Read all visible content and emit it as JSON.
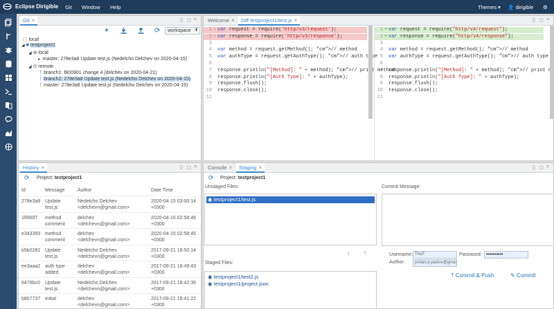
{
  "app": {
    "title": "Eclipse Dirigible",
    "menu": [
      "Git",
      "Window",
      "Help"
    ],
    "themes_label": "Themes",
    "user": "dirigible"
  },
  "git_panel": {
    "tab": "Git",
    "workspace": "workspace",
    "tree": {
      "local_root": "local",
      "project": "testproject1",
      "local": "local",
      "local_master": "master: 278e3a8 Update test.js (Nedelcho Delchev on 2020-04-15)",
      "remote": "remote",
      "branch1": "branch1: f800901 change 4 (delchev on 2020-04-21)",
      "branch2": "branch2: 278e3a8 Update test.js (Nedelcho Delchev on 2020-04-15)",
      "remote_master": "master: 278e3a8 Update test.js (Nedelcho Delchev on 2020-04-15)"
    }
  },
  "editor": {
    "tabs": [
      "Welcome",
      "Diff testproject1/test.js"
    ],
    "left_lines": [
      {
        "n": "1",
        "text": "var request = require('http/v3/request');"
      },
      {
        "n": "2",
        "text": "var response = require('http/v3/response');"
      },
      {
        "n": "3",
        "text": ""
      },
      {
        "n": "4",
        "text": "var method = request.getMethod(); // method"
      },
      {
        "n": "5",
        "text": "var authType = request.getAuthType(); // auth type"
      },
      {
        "n": "6",
        "text": ""
      },
      {
        "n": "7",
        "text": "response.println(\"[Method]: \" + method); // print method"
      },
      {
        "n": "8",
        "text": "response.println(\"[Auth Type]: \" + authType);"
      },
      {
        "n": "9",
        "text": "response.flush();"
      },
      {
        "n": "10",
        "text": "response.close();"
      },
      {
        "n": "11",
        "text": ""
      }
    ],
    "right_lines": [
      {
        "n": "1",
        "text": "var request = require(\"http/v4/request\");"
      },
      {
        "n": "2",
        "text": "var response = require(\"http/v4/response\");"
      },
      {
        "n": "3",
        "text": ""
      },
      {
        "n": "4",
        "text": "var method = request.getMethod(); // method"
      },
      {
        "n": "5",
        "text": "var authType = request.getAuthType(); // auth type"
      },
      {
        "n": "6",
        "text": ""
      },
      {
        "n": "7",
        "text": "response.println(\"[Method]: \" + method); // print method"
      },
      {
        "n": "8",
        "text": "response.println(\"[Auth Type]: \" + authType);"
      },
      {
        "n": "9",
        "text": "response.flush();"
      },
      {
        "n": "10",
        "text": "response.close();"
      },
      {
        "n": "11",
        "text": ""
      }
    ]
  },
  "history": {
    "tab": "History",
    "project_label": "Project:",
    "project": "testproject1",
    "columns": [
      "Id",
      "Message",
      "Author",
      "Date Time"
    ],
    "rows": [
      {
        "id": "278e3a8",
        "msg": [
          "Update",
          "test.js"
        ],
        "author": [
          "Nedelcho Delchev",
          "<delchevn@gmail.com>"
        ],
        "date": [
          "2020-04-15 03:00:14",
          "+0300"
        ]
      },
      {
        "id": "1f890f7",
        "msg": [
          "method",
          "comment"
        ],
        "author": [
          "delchev",
          "<delchevn@gmail.com>"
        ],
        "date": [
          "2020-04-15 02:58:46",
          "+0300"
        ]
      },
      {
        "id": "e343393",
        "msg": [
          "method",
          "comment"
        ],
        "author": [
          "delchev",
          "<delchevn@gmail.com>"
        ],
        "date": [
          "2020-04-15 02:58:45",
          "+0300"
        ]
      },
      {
        "id": "b5b0281",
        "msg": [
          "Update",
          "test.js"
        ],
        "author": [
          "Nedelcho Delchev",
          "<delchevn@gmail.com>"
        ],
        "date": [
          "2017-09-21 18:50:14",
          "+0300"
        ]
      },
      {
        "id": "ee3aaa2",
        "msg": [
          "auth type",
          "added"
        ],
        "author": [
          "delchev",
          "<delchevn@gmail.com>"
        ],
        "date": [
          "2017-09-21 18:49:43",
          "+0300"
        ]
      },
      {
        "id": "6478bc0",
        "msg": [
          "Update",
          "test.js"
        ],
        "author": [
          "Nedelcho Delchev",
          "<delchevn@gmail.com>"
        ],
        "date": [
          "2017-09-21 18:42:36",
          "+0300"
        ]
      },
      {
        "id": "b807737",
        "msg": [
          "initial",
          ""
        ],
        "author": [
          "delchev",
          "<delchevn@gmail.com>"
        ],
        "date": [
          "2017-09-21 18:41:22",
          "+0300"
        ]
      }
    ]
  },
  "staging": {
    "tabs": [
      "Console",
      "Staging"
    ],
    "project_label": "Project:",
    "project": "testproject1",
    "unstaged_label": "Unstaged Files:",
    "unstaged": [
      "testproject1/test.js"
    ],
    "staged_label": "Staged Files:",
    "staged": [
      "testproject1/test2.js",
      "testproject1/project.json"
    ],
    "commit_message_label": "Commit Message:",
    "username_label": "Username:",
    "username": "ThuF",
    "password_label": "Password:",
    "password": "••••••••••",
    "author_label": "Author:",
    "author": "jordan.p.pavlov@gmail...",
    "commit_push": "Commit & Push",
    "commit": "Commit"
  }
}
